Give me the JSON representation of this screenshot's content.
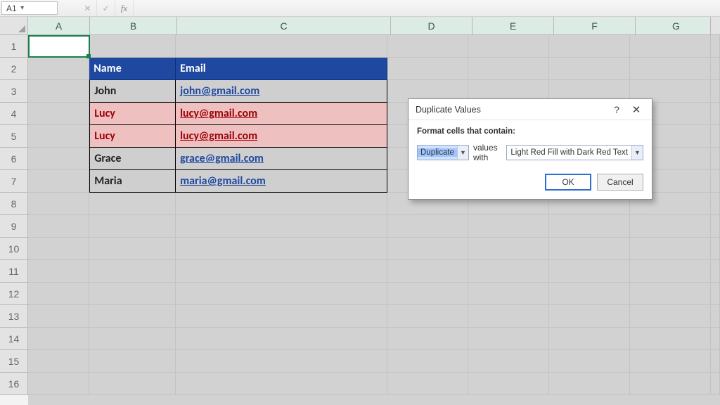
{
  "name_box": "A1",
  "fx_label": "fx",
  "columns": [
    "A",
    "B",
    "C",
    "D",
    "E",
    "F",
    "G"
  ],
  "rows": [
    "1",
    "2",
    "3",
    "4",
    "5",
    "6",
    "7",
    "8",
    "9",
    "10",
    "11",
    "12",
    "13",
    "14",
    "15",
    "16"
  ],
  "table": {
    "headers": {
      "name": "Name",
      "email": "Email"
    },
    "data": [
      {
        "name": "John",
        "email": "john@gmail.com",
        "dup": false
      },
      {
        "name": "Lucy",
        "email": "lucy@gmail.com",
        "dup": true
      },
      {
        "name": "Lucy",
        "email": "lucy@gmail.com",
        "dup": true
      },
      {
        "name": "Grace",
        "email": "grace@gmail.com",
        "dup": false
      },
      {
        "name": "Maria",
        "email": "maria@gmail.com",
        "dup": false
      }
    ]
  },
  "dialog": {
    "title": "Duplicate Values",
    "label": "Format cells that contain:",
    "type_dd": "Duplicate",
    "values_with": "values with",
    "format_dd": "Light Red Fill with Dark Red Text",
    "ok": "OK",
    "cancel": "Cancel",
    "help": "?",
    "close": "✕"
  },
  "fb_icons": {
    "cancel": "✕",
    "accept": "✓"
  }
}
